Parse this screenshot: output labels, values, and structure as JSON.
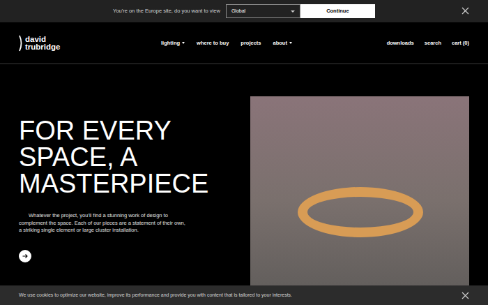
{
  "region_banner": {
    "message": "You're on the Europe site, do you want to view",
    "select": {
      "value": "Global"
    },
    "button": "Continue"
  },
  "header": {
    "logo": {
      "line1": "david",
      "line2": "trubridge"
    },
    "nav": [
      {
        "label": "lighting",
        "dropdown": true
      },
      {
        "label": "where to buy",
        "dropdown": false
      },
      {
        "label": "projects",
        "dropdown": false
      },
      {
        "label": "about",
        "dropdown": true
      }
    ],
    "utility": [
      "downloads",
      "search",
      "cart (0)"
    ]
  },
  "hero": {
    "heading_lines": [
      "FOR EVERY",
      "SPACE, A",
      "MASTERPIECE"
    ],
    "body": "Whatever the project, you'll find a stunning work of design to complement the space. Each of our pieces are a statement of their own, a striking single element or large cluster installation."
  },
  "cookie_bar": {
    "message": "We use cookies to optimize our website, improve its performance and provide you with content that is tailored to your interests."
  }
}
